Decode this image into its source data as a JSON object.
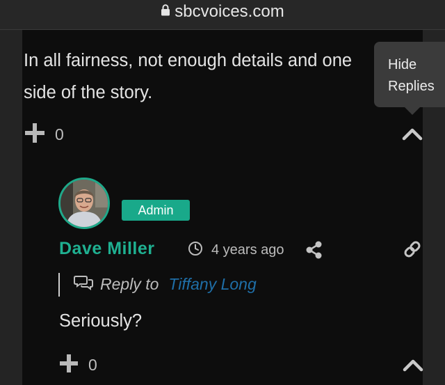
{
  "browser": {
    "url": "sbcvoices.com",
    "lock_icon": "lock-icon"
  },
  "colors": {
    "accent": "#1fb091",
    "badge": "#19a98a",
    "link": "#1f6fa8",
    "background": "#0d0d0d"
  },
  "parent_comment": {
    "text": "In all fairness, not enough details and one side of the story.",
    "vote_count": "0",
    "upvote_icon": "plus-icon",
    "collapse_icon": "chevron-up-icon"
  },
  "tooltip": {
    "line1": "Hide",
    "line2": "Replies"
  },
  "reply_comment": {
    "avatar_icon": "avatar-photo",
    "badge": "Admin",
    "author": "Dave Miller",
    "time_icon": "clock-icon",
    "time": "4 years ago",
    "share_icon": "share-icon",
    "link_icon": "link-icon",
    "reply_icon": "chat-bubbles-icon",
    "reply_label": "Reply to",
    "reply_to": "Tiffany Long",
    "text": "Seriously?",
    "vote_count": "0"
  }
}
